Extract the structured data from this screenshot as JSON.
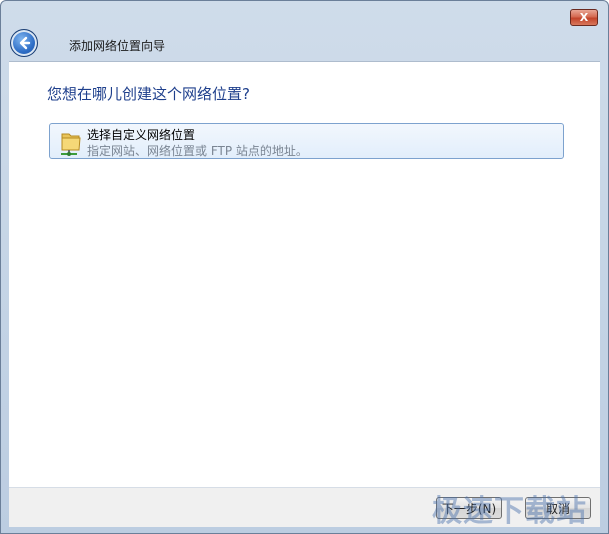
{
  "window": {
    "close_label": "X",
    "wizard_title": "添加网络位置向导"
  },
  "content": {
    "question": "您想在哪儿创建这个网络位置?",
    "options": [
      {
        "title": "选择自定义网络位置",
        "description": "指定网站、网络位置或 FTP 站点的地址。",
        "icon": "folder-network-icon"
      }
    ]
  },
  "footer": {
    "next_label": "下一步(N)",
    "cancel_label": "取消"
  },
  "watermark": "极速下载站",
  "colors": {
    "question_text": "#1e3f8c",
    "option_border": "#7da2ce",
    "close_button": "#c2442b"
  }
}
